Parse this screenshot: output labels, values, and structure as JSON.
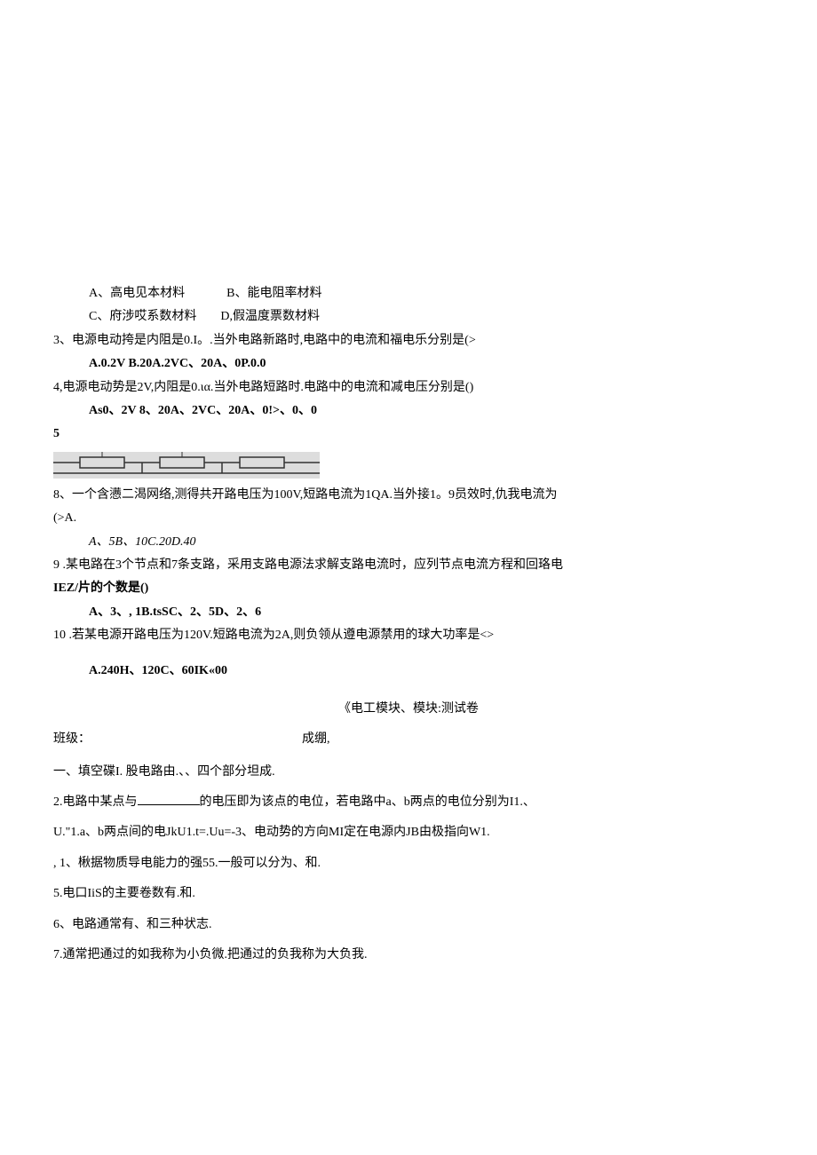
{
  "q2_opts": {
    "a": "A、高电见本材料",
    "b": "B、能电阻率材料",
    "c": "C、府涉哎系数材料",
    "d": "D,假温度票数材料"
  },
  "q3": {
    "text": "3、电源电动挎是内阻是0.I。.当外电路新路时,电路中的电流和福电乐分别是(>",
    "opts": "A.0.2V            B.20A.2VC、20A、0P.0.0"
  },
  "q4": {
    "text": "4,电源电动势是2V,内阻是0.ια.当外电路短路时.电路中的电流和减电压分别是()",
    "opts": "As0、2V        8、20A、2VC、20A、0!>、0、0"
  },
  "q5": "5",
  "q8": {
    "text1": "8、一个含懑二渴网络,测得共开路电压为100V,短路电流为1QA.当外接1。9员效时,仇我电流为",
    "text2": "(>A.",
    "opts": "A、5B、10C.20D.40"
  },
  "q9": {
    "text1": "9   .某电路在3个节点和7条支路，采用支路电源法求解支路电流时，应列节点电流方程和回珞电",
    "text2": "IEZ/片的个数是()",
    "opts": "A、3、, 1B.tsSC、2、5D、2、6"
  },
  "q10": {
    "text": "10   .若某电源开路电压为120V.短路电流为2A,则负领从遵电源禁用的球大功率是<>",
    "opts": "A.240H、120C、60IK«00"
  },
  "exam": {
    "title": "《电工模块、模块:测试卷",
    "class_label": "班级：",
    "score_label": "成绷,",
    "s1": "一、填空碟I.           股电路由.、、四个部分坦成.",
    "s2_a": "2.电路中某点与",
    "s2_b": "的电压即为该点的电位，若电路中a、b两点的电位分别为I1.、",
    "s3": "U.\"1.a、b两点间的电JkU1.t=.Uu=-3、电动势的方向MI定在电源内JB由极指向W1.",
    "s4": ", 1、楸据物质导电能力的强55.一般可以分为、和.",
    "s5": "5.电口IiS的主要卷数有.和.",
    "s6": "6、电路通常有、和三种状志.",
    "s7": "7.通常把通过的如我称为小负微.把通过的负我称为大负我."
  }
}
